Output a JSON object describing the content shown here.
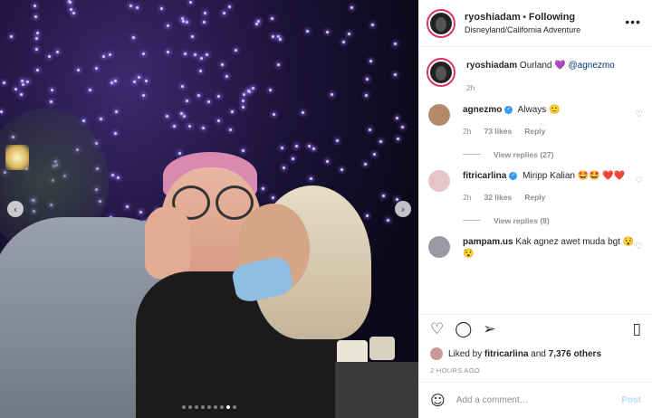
{
  "media": {
    "prev_label": "‹",
    "next_label": "›",
    "carousel": {
      "total": 9,
      "active_index": 7
    }
  },
  "header": {
    "username": "ryoshiadam",
    "separator": "•",
    "following_label": "Following",
    "location": "Disneyland/California Adventure",
    "more_label": "•••"
  },
  "caption": {
    "username": "ryoshiadam",
    "text": "Ourland",
    "emoji": "💜",
    "mention": "@agnezmo",
    "time": "2h"
  },
  "comments": [
    {
      "username": "agnezmo",
      "verified": true,
      "text": "Always 🙂",
      "time": "2h",
      "likes": "73 likes",
      "reply_label": "Reply",
      "replies_label": "View replies (27)"
    },
    {
      "username": "fitricarlina",
      "verified": true,
      "text": "Miripp Kalian 🤩🤩 ❤️❤️",
      "time": "2h",
      "likes": "32 likes",
      "reply_label": "Reply",
      "replies_label": "View replies (8)"
    },
    {
      "username": "pampam.us",
      "verified": false,
      "text": "Kak agnez awet muda bgt 😯😯"
    }
  ],
  "actions": {
    "like_icon": "♡",
    "comment_icon": "◯",
    "share_icon": "➢",
    "save_icon": "▯"
  },
  "likes": {
    "prefix": "Liked by",
    "user": "fitricarlina",
    "and": "and",
    "others": "7,376 others"
  },
  "timestamp": "2 HOURS AGO",
  "add_comment": {
    "emoji_icon": "☺",
    "placeholder": "Add a comment…",
    "post_label": "Post"
  },
  "colors": {
    "link": "#00376b",
    "post_disabled": "#b2dffc",
    "verified": "#3897f0"
  }
}
